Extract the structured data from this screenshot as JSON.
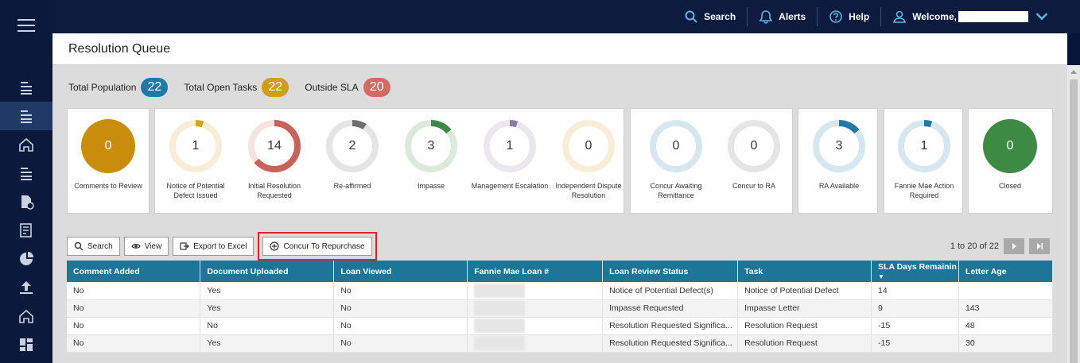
{
  "topbar": {
    "search": "Search",
    "alerts": "Alerts",
    "help": "Help",
    "welcome": "Welcome,"
  },
  "page": {
    "title": "Resolution Queue"
  },
  "summary": {
    "total_population_label": "Total Population",
    "total_population": "22",
    "total_open_tasks_label": "Total Open Tasks",
    "total_open_tasks": "22",
    "outside_sla_label": "Outside SLA",
    "outside_sla": "20"
  },
  "tiles": [
    {
      "label": "Comments to Review",
      "count": "0",
      "color": "#c98c0b",
      "fill": 1.0
    },
    {
      "label": "Notice of Potential Defect Issued",
      "count": "1",
      "color": "#d6a227",
      "fill": 0.05
    },
    {
      "label": "Initial Resolution Requested",
      "count": "14",
      "color": "#c9625b",
      "fill": 0.64
    },
    {
      "label": "Re-affirmed",
      "count": "2",
      "color": "#6e6e6e",
      "fill": 0.09
    },
    {
      "label": "Impasse",
      "count": "3",
      "color": "#3c8a4a",
      "fill": 0.14
    },
    {
      "label": "Management Escalation",
      "count": "1",
      "color": "#8b7ba8",
      "fill": 0.05
    },
    {
      "label": "Independent Dispute Resolution",
      "count": "0",
      "color": "#d6a227",
      "fill": 0.0
    },
    {
      "label": "Concur Awaiting Remittance",
      "count": "0",
      "color": "#2279a6",
      "fill": 0.0
    },
    {
      "label": "Concur to RA",
      "count": "0",
      "color": "#6e6e6e",
      "fill": 0.0
    },
    {
      "label": "RA Available",
      "count": "3",
      "color": "#2279a6",
      "fill": 0.14
    },
    {
      "label": "Fannie Mae Action Required",
      "count": "1",
      "color": "#2279a6",
      "fill": 0.05
    },
    {
      "label": "Closed",
      "count": "0",
      "color": "#3d8a44",
      "fill": 1.0
    }
  ],
  "toolbar": {
    "search": "Search",
    "view": "View",
    "export": "Export to Excel",
    "concur": "Concur To Repurchase"
  },
  "pager": {
    "text": "1 to 20 of 22"
  },
  "table": {
    "headers": [
      "Comment Added",
      "Document Uploaded",
      "Loan Viewed",
      "Fannie Mae Loan #",
      "Loan Review Status",
      "Task",
      "SLA Days Remainin",
      "Letter Age"
    ],
    "rows": [
      [
        "No",
        "Yes",
        "No",
        "",
        "Notice of Potential Defect(s)",
        "Notice of Potential Defect",
        "14",
        ""
      ],
      [
        "No",
        "Yes",
        "No",
        "",
        "Impasse Requested",
        "Impasse Letter",
        "9",
        "143"
      ],
      [
        "No",
        "No",
        "No",
        "",
        "Resolution Requested Significa...",
        "Resolution Request",
        "-15",
        "48"
      ],
      [
        "No",
        "Yes",
        "No",
        "",
        "Resolution Requested Significa...",
        "Resolution Request",
        "-15",
        "30"
      ]
    ]
  },
  "colors": {
    "sidebar": "#0b1a3c",
    "header_blue": "#1d7598",
    "highlight_red": "#d8262b"
  }
}
